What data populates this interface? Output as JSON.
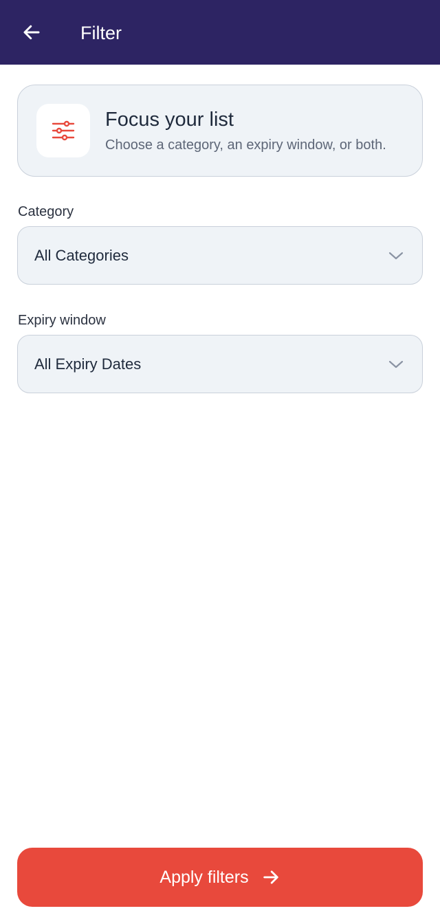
{
  "header": {
    "title": "Filter",
    "background": "#2d2463"
  },
  "intro": {
    "title": "Focus your list",
    "subtitle": "Choose a category, an expiry window, or both.",
    "icon": "sliders-icon",
    "accent": "#e8493c"
  },
  "filters": {
    "category": {
      "label": "Category",
      "value": "All Categories"
    },
    "expiry": {
      "label": "Expiry window",
      "value": "All Expiry Dates"
    }
  },
  "footer": {
    "apply_label": "Apply filters",
    "apply_icon": "arrow-right-icon",
    "button_color": "#e8493c"
  }
}
